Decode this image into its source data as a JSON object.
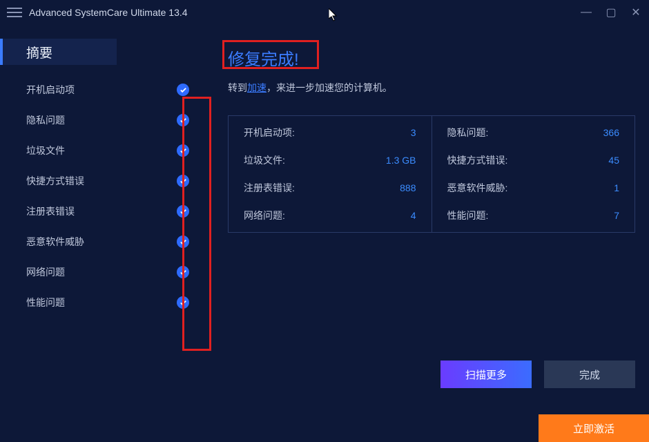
{
  "titlebar": {
    "title": "Advanced SystemCare Ultimate 13.4"
  },
  "sidebar": {
    "summary": "摘要",
    "items": [
      {
        "label": "开机启动项"
      },
      {
        "label": "隐私问题"
      },
      {
        "label": "垃圾文件"
      },
      {
        "label": "快捷方式错误"
      },
      {
        "label": "注册表错误"
      },
      {
        "label": "恶意软件威胁"
      },
      {
        "label": "网络问题"
      },
      {
        "label": "性能问题"
      }
    ]
  },
  "content": {
    "headline": "修复完成!",
    "subline_prefix": "转到",
    "subline_link": "加速",
    "subline_suffix": "，来进一步加速您的计算机。",
    "stats": {
      "left": [
        {
          "label": "开机启动项:",
          "value": "3"
        },
        {
          "label": "垃圾文件:",
          "value": "1.3 GB"
        },
        {
          "label": "注册表错误:",
          "value": "888"
        },
        {
          "label": "网络问题:",
          "value": "4"
        }
      ],
      "right": [
        {
          "label": "隐私问题:",
          "value": "366"
        },
        {
          "label": "快捷方式错误:",
          "value": "45"
        },
        {
          "label": "恶意软件威胁:",
          "value": "1"
        },
        {
          "label": "性能问题:",
          "value": "7"
        }
      ]
    },
    "scan_more": "扫描更多",
    "done": "完成",
    "activate": "立即激活"
  }
}
